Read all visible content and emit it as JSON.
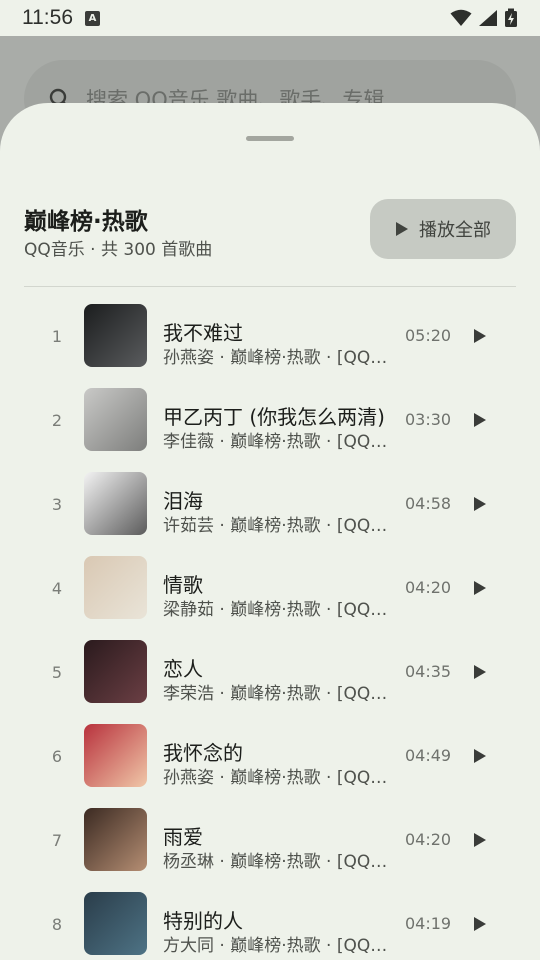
{
  "status_bar": {
    "time": "11:56",
    "notif_letter": "A"
  },
  "background": {
    "search_placeholder": "搜索 QQ音乐 歌曲、歌手、专辑"
  },
  "sheet": {
    "title": "巅峰榜·热歌",
    "subtitle": "QQ音乐 · 共 300 首歌曲",
    "play_all_label": "播放全部"
  },
  "songs": [
    {
      "index": "1",
      "title": "我不难过",
      "subtitle": "孙燕姿 · 巅峰榜·热歌 · [QQ音乐]",
      "duration": "05:20",
      "cover_colors": [
        "#1b1d1e",
        "#5a5c5e"
      ]
    },
    {
      "index": "2",
      "title": "甲乙丙丁 (你我怎么两清)",
      "subtitle": "李佳薇 · 巅峰榜·热歌 · [QQ音乐]",
      "duration": "03:30",
      "cover_colors": [
        "#c9c9c7",
        "#7d7e7c"
      ]
    },
    {
      "index": "3",
      "title": "泪海",
      "subtitle": "许茹芸 · 巅峰榜·热歌 · [QQ音乐]",
      "duration": "04:58",
      "cover_colors": [
        "#f3f3f3",
        "#5b5b5b"
      ]
    },
    {
      "index": "4",
      "title": "情歌",
      "subtitle": "梁静茹 · 巅峰榜·热歌 · [QQ音乐]",
      "duration": "04:20",
      "cover_colors": [
        "#d9c8b3",
        "#e9e4d8"
      ]
    },
    {
      "index": "5",
      "title": "恋人",
      "subtitle": "李荣浩 · 巅峰榜·热歌 · [QQ音乐]",
      "duration": "04:35",
      "cover_colors": [
        "#2a1a1d",
        "#6b3f44"
      ]
    },
    {
      "index": "6",
      "title": "我怀念的",
      "subtitle": "孙燕姿 · 巅峰榜·热歌 · [QQ音乐]",
      "duration": "04:49",
      "cover_colors": [
        "#b8323d",
        "#f0c7a8"
      ]
    },
    {
      "index": "7",
      "title": "雨爱",
      "subtitle": "杨丞琳 · 巅峰榜·热歌 · [QQ音乐]",
      "duration": "04:20",
      "cover_colors": [
        "#3b2a22",
        "#b58e73"
      ]
    },
    {
      "index": "8",
      "title": "特别的人",
      "subtitle": "方大同 · 巅峰榜·热歌 · [QQ音乐]",
      "duration": "04:19",
      "cover_colors": [
        "#2a3d4a",
        "#4e7385"
      ]
    }
  ]
}
